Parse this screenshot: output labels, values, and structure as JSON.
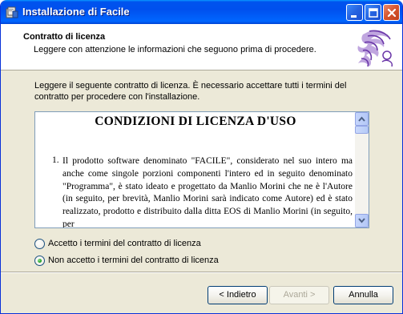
{
  "window": {
    "title": "Installazione di Facile"
  },
  "header": {
    "title": "Contratto di licenza",
    "subtitle": "Leggere con attenzione le informazioni che seguono prima di procedere."
  },
  "intro": "Leggere il seguente contratto di licenza. È necessario accettare tutti i termini del contratto per procedere con l'installazione.",
  "license": {
    "heading": "CONDIZIONI DI LICENZA D'USO",
    "clause_number": "1.",
    "clause_text": "Il prodotto software denominato \"FACILE\", considerato nel suo intero ma anche come singole porzioni componenti l'intero ed in seguito denominato \"Programma\", è stato ideato e progettato da Manlio Morini che ne è l'Autore (in seguito, per brevità, Manlio Morini sarà indicato come Autore) ed è stato realizzato, prodotto e distribuito dalla ditta EOS di Manlio Morini (in seguito, per"
  },
  "options": {
    "accept_label": "Accetto i termini del contratto di licenza",
    "decline_label": "Non accetto i termini del contratto di licenza",
    "selected": "decline"
  },
  "buttons": {
    "back": "< Indietro",
    "next": "Avanti >",
    "cancel": "Annulla"
  },
  "icons": {
    "app": "installer-icon",
    "logo": "facile-logo"
  },
  "colors": {
    "titlebar": "#0053ee",
    "dialog_bg": "#ece9d8",
    "logo": "#7b4bb3"
  }
}
